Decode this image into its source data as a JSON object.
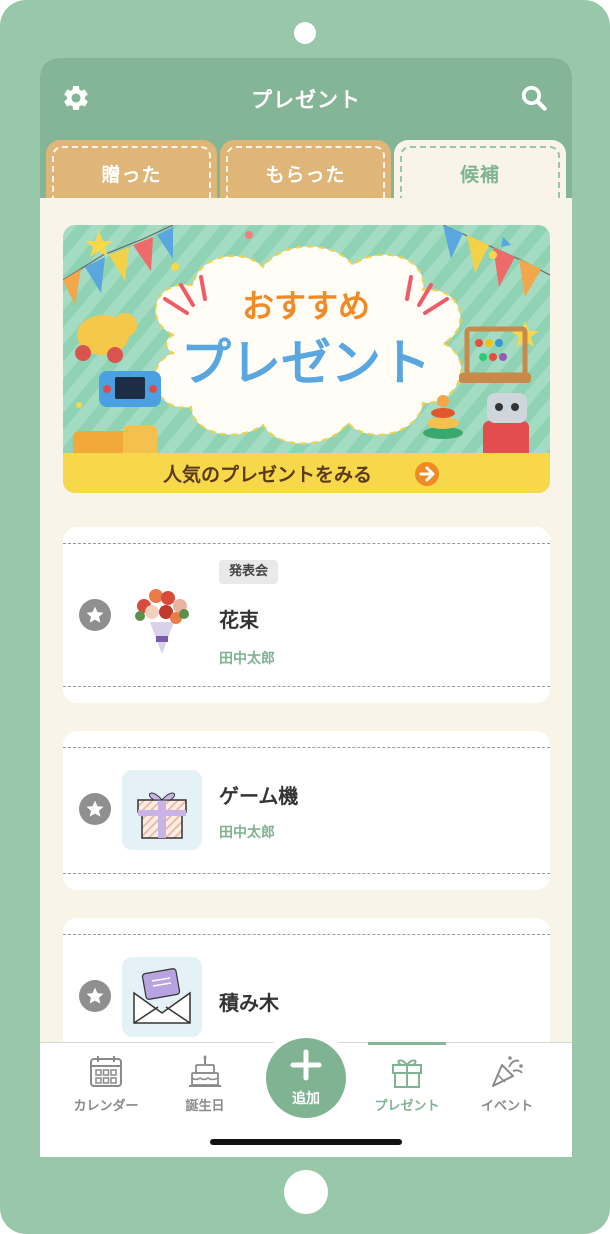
{
  "header": {
    "title": "プレゼント"
  },
  "tabs": [
    {
      "label": "贈った",
      "active": false
    },
    {
      "label": "もらった",
      "active": false
    },
    {
      "label": "候補",
      "active": true
    }
  ],
  "banner": {
    "line1": "おすすめ",
    "line2": "プレゼント",
    "cta": "人気のプレゼントをみる"
  },
  "gifts": [
    {
      "tag": "発表会",
      "name": "花束",
      "person": "田中太郎",
      "thumb": "bouquet"
    },
    {
      "tag": "",
      "name": "ゲーム機",
      "person": "田中太郎",
      "thumb": "gift-box"
    },
    {
      "tag": "",
      "name": "積み木",
      "person": "",
      "thumb": "envelope"
    }
  ],
  "nav": {
    "calendar": "カレンダー",
    "birthday": "誕生日",
    "add": "追加",
    "present": "プレゼント",
    "event": "イベント"
  },
  "colors": {
    "frame": "#98c8a9",
    "header": "#83b596",
    "accent": "#7fb392",
    "tab_off": "#e0b578",
    "background": "#f8f5e8"
  },
  "icons": [
    "gear-icon",
    "search-icon",
    "star-icon",
    "calendar-icon",
    "cake-icon",
    "plus-icon",
    "gift-icon",
    "party-popper-icon"
  ]
}
